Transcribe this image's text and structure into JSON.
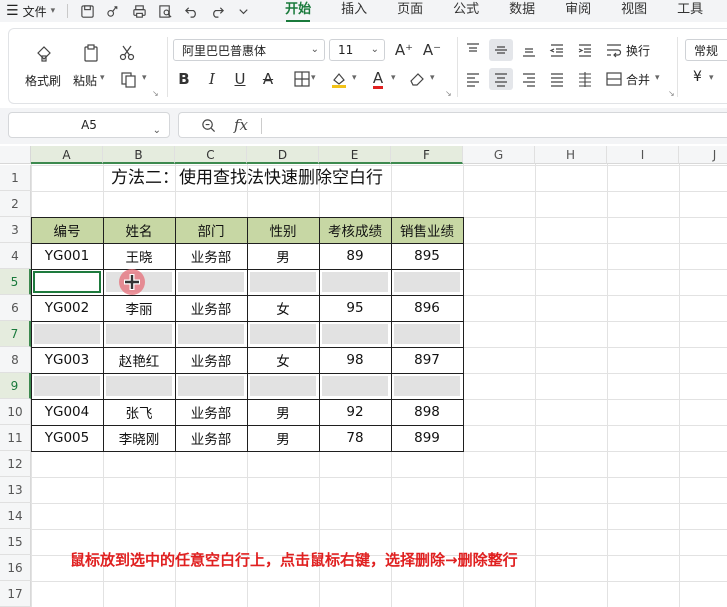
{
  "menu": {
    "file_label": "文件",
    "tabs": [
      "开始",
      "插入",
      "页面",
      "公式",
      "数据",
      "审阅",
      "视图",
      "工具"
    ],
    "active_tab": "开始"
  },
  "ribbon": {
    "format_painter": "格式刷",
    "paste": "粘贴",
    "font_name": "阿里巴巴普惠体",
    "font_size": "11",
    "wrap": "换行",
    "merge": "合并",
    "number_format": "常规",
    "currency_symbol": "¥",
    "bold": "B",
    "italic": "I",
    "underline": "U",
    "strike": "A",
    "font_color": "A",
    "grow_font": "A⁺",
    "shrink_font": "A⁻"
  },
  "formula_bar": {
    "name_box": "A5",
    "fx": "fx",
    "content": ""
  },
  "sheet": {
    "columns": [
      "A",
      "B",
      "C",
      "D",
      "E",
      "F",
      "G",
      "H",
      "I",
      "J"
    ],
    "rows": [
      "1",
      "2",
      "3",
      "4",
      "5",
      "6",
      "7",
      "8",
      "9",
      "10",
      "11",
      "12",
      "13",
      "14",
      "15",
      "16",
      "17"
    ],
    "title": "方法二：使用查找法快速删除空白行",
    "table_headers": [
      "编号",
      "姓名",
      "部门",
      "性别",
      "考核成绩",
      "销售业绩"
    ],
    "table_rows": [
      [
        "YG001",
        "王晓",
        "业务部",
        "男",
        "89",
        "895"
      ],
      [
        "",
        "",
        "",
        "",
        "",
        ""
      ],
      [
        "YG002",
        "李丽",
        "业务部",
        "女",
        "95",
        "896"
      ],
      [
        "",
        "",
        "",
        "",
        "",
        ""
      ],
      [
        "YG003",
        "赵艳红",
        "业务部",
        "女",
        "98",
        "897"
      ],
      [
        "",
        "",
        "",
        "",
        "",
        ""
      ],
      [
        "YG004",
        "张飞",
        "业务部",
        "男",
        "92",
        "898"
      ],
      [
        "YG005",
        "李晓刚",
        "业务部",
        "男",
        "78",
        "899"
      ]
    ],
    "selected_rows": [
      "5",
      "7",
      "9"
    ],
    "active_cell": "A5"
  },
  "caption": "鼠标放到选中的任意空白行上，点击鼠标右键，选择删除→删除整行",
  "colors": {
    "accent": "#1a7a3c",
    "header_fill": "#c7d7a4",
    "empty_fill": "#e2e2e2",
    "caption": "#e02020"
  }
}
